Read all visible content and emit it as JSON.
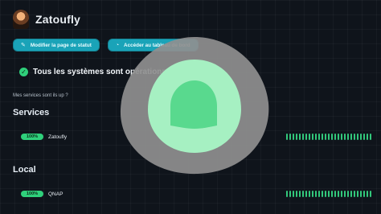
{
  "header": {
    "title": "Zatoufly",
    "avatar_icon": "avatar"
  },
  "actions": {
    "edit_status_page": {
      "label": "Modifier la page de statut",
      "icon": "pencil-icon"
    },
    "open_dashboard": {
      "label": "Accéder au tableau de bord",
      "icon": "dashboard-icon"
    }
  },
  "status": {
    "message": "Tous les systèmes sont opérationnels",
    "icon": "check-circle-icon"
  },
  "uptime_question": "Mes services sont ils up ?",
  "sections": [
    {
      "title": "Services",
      "monitor": {
        "uptime": "100%",
        "name": "Zatoufly"
      }
    },
    {
      "title": "Local",
      "monitor": {
        "uptime": "100%",
        "name": "QNAP"
      }
    }
  ],
  "colors": {
    "accent": "#1aa3b8",
    "success": "#2fd07b",
    "background": "#0f141b"
  }
}
